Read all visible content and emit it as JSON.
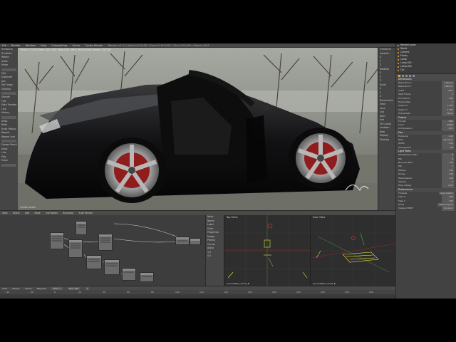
{
  "topbar": {
    "menus": [
      "File",
      "Render",
      "Window",
      "Help",
      "Compositing",
      "Scene",
      "Cycles Render"
    ],
    "info": "Blender v2.71 | Verts:2,216,483 | Faces:2,149,920 | Tris:4,299,840 | Objects:0/93"
  },
  "left_tools": {
    "items": [
      "Transform",
      "Translate",
      "Rotate",
      "Scale",
      "Mirror",
      "Edit",
      "Duplicate",
      "Join",
      "Set Origin",
      "Shading",
      "Smooth",
      "Flat",
      "Data Transfer",
      "Link",
      "History",
      "Undo",
      "Redo",
      "Undo History",
      "Repeat",
      "Repeat Last",
      "Grease Pencil",
      "Draw",
      "Line",
      "Poly",
      "Erase"
    ]
  },
  "render_view": {
    "info": "Time:11:11.04 | Mem:1482.10M, Peak:1491.56M | Path Tracing Sample 128/128",
    "corner_label": "Cycles render"
  },
  "right_tools": {
    "items": [
      "Transform",
      "Location",
      "X",
      "Y",
      "Z",
      "Rotation",
      "X",
      "Y",
      "Z",
      "Scale",
      "X",
      "Y",
      "Z",
      "Dimensions",
      "View",
      "Lens",
      "Clip",
      "Start",
      "End",
      "3D Cursor",
      "Location",
      "Item",
      "Display",
      "Shading"
    ]
  },
  "outliner": {
    "rows": [
      "RenderLayers",
      "World",
      "Camera",
      "Empty",
      "Lamp",
      "Lamp.001",
      "Lamp.002",
      "Car"
    ]
  },
  "properties": {
    "sections": [
      {
        "title": "Dimensions",
        "rows": [
          [
            "Resolution X",
            "1920 px"
          ],
          [
            "Resolution Y",
            "1080 px"
          ],
          [
            "Scale",
            "50%"
          ],
          [
            "Start Frame",
            "1"
          ],
          [
            "End Frame",
            "250"
          ],
          [
            "Frame Step",
            "1"
          ],
          [
            "Aspect X",
            "1.000"
          ],
          [
            "Aspect Y",
            "1.000"
          ],
          [
            "Frame Rate",
            "24 fps"
          ]
        ]
      },
      {
        "title": "Output",
        "rows": [
          [
            "Format",
            "PNG"
          ],
          [
            "Color",
            "RGBA"
          ],
          [
            "Compression",
            "15%"
          ]
        ]
      },
      {
        "title": "Film",
        "rows": [
          [
            "Exposure",
            "1.00"
          ],
          [
            "Filter",
            "Gaussian"
          ],
          [
            "Width",
            "1.50"
          ],
          [
            "Transparent",
            "Off"
          ]
        ]
      },
      {
        "title": "Light Paths",
        "rows": [
          [
            "Transparency Max",
            "8"
          ],
          [
            "Min",
            "8"
          ],
          [
            "Bounces Max",
            "128"
          ],
          [
            "Min",
            "3"
          ],
          [
            "Diffuse",
            "128"
          ],
          [
            "Glossy",
            "128"
          ],
          [
            "Transmission",
            "128"
          ],
          [
            "Volume",
            "0"
          ],
          [
            "Filter Glossy",
            "0.00"
          ]
        ]
      },
      {
        "title": "Performance",
        "rows": [
          [
            "Threads",
            "Auto-detect"
          ],
          [
            "Tiles X",
            "256"
          ],
          [
            "Tiles Y",
            "256"
          ],
          [
            "Order",
            "Hilbert Spiral"
          ],
          [
            "Viewport BVH",
            "Dynamic"
          ]
        ]
      }
    ]
  },
  "mid_toolbar": {
    "items": [
      "View",
      "Select",
      "Add",
      "Node",
      "Use Nodes",
      "Backdrop",
      "Auto Render"
    ]
  },
  "node_tools": {
    "items": [
      "Node",
      "Name",
      "Label",
      "Color",
      "Properties",
      "Image",
      "Premul",
      "Curves",
      "Alpha",
      "1.0",
      "0.5"
    ]
  },
  "viewports": [
    {
      "title": "Top Ortho",
      "footer": "(1) sunflex1_carrot_B"
    },
    {
      "title": "User Ortho",
      "footer": "(1) sunflex1_carrot_B"
    }
  ],
  "bottom_toolbar": {
    "items": [
      "View",
      "Marker",
      "Frame",
      "Playback",
      "Start: 1",
      "End: 250",
      "1"
    ]
  },
  "timeline": {
    "ticks": [
      "-40",
      "-20",
      "0",
      "20",
      "40",
      "60",
      "80",
      "100",
      "120",
      "140",
      "160",
      "180",
      "200",
      "220",
      "240",
      "260"
    ]
  },
  "colors": {
    "accent": "#e9a13b",
    "panel": "#424242",
    "dark": "#2e2e2e"
  }
}
